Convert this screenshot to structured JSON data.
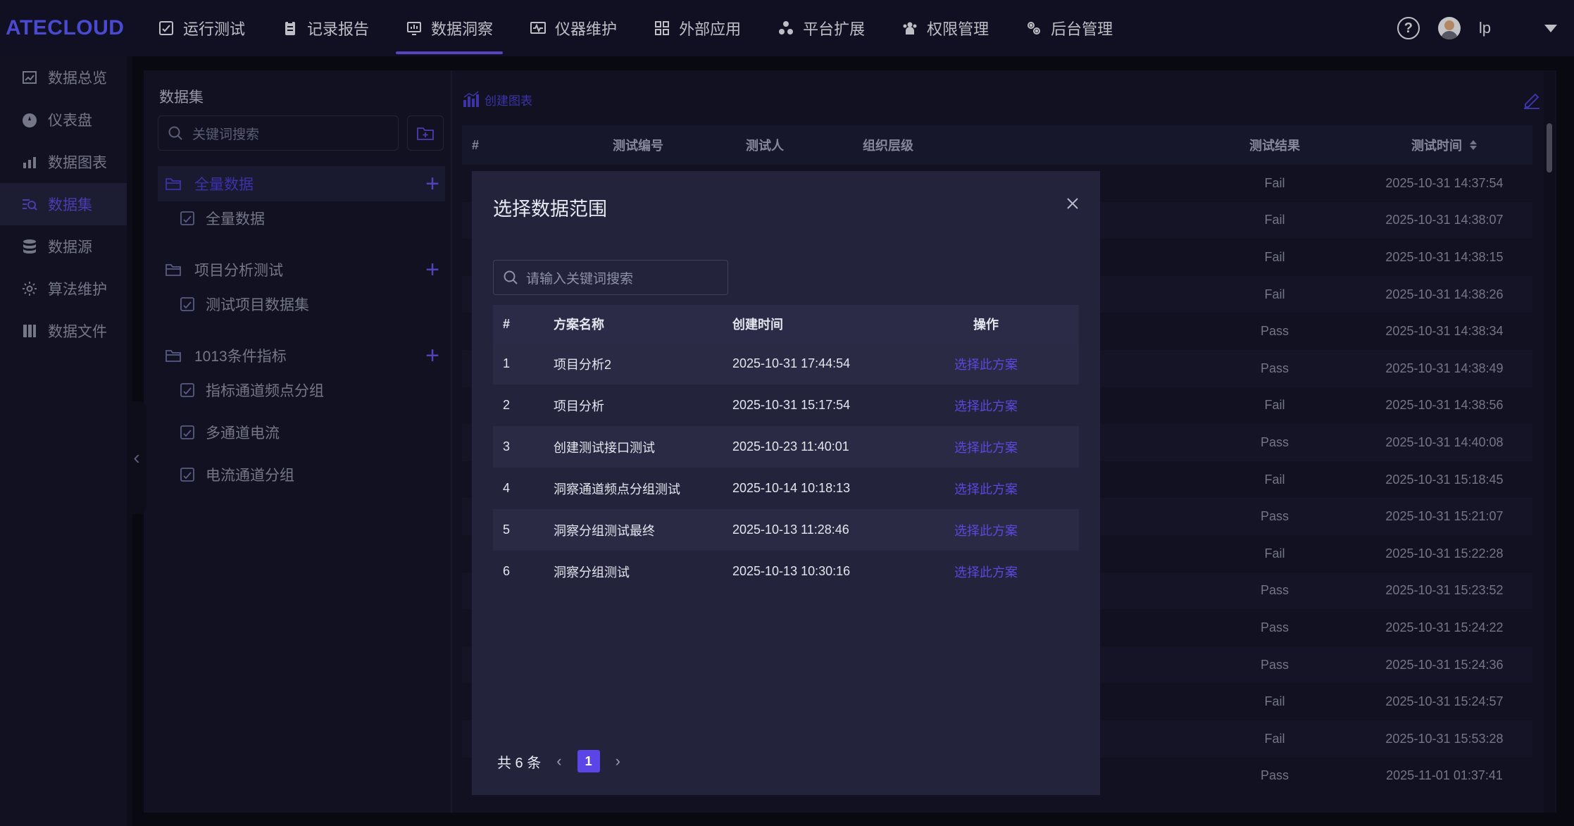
{
  "app": {
    "logo": "ATECLOUD"
  },
  "topnav": [
    {
      "label": "运行测试",
      "icon": "run-test-icon"
    },
    {
      "label": "记录报告",
      "icon": "report-icon"
    },
    {
      "label": "数据洞察",
      "icon": "insight-icon",
      "active": true
    },
    {
      "label": "仪器维护",
      "icon": "instrument-icon"
    },
    {
      "label": "外部应用",
      "icon": "apps-icon"
    },
    {
      "label": "平台扩展",
      "icon": "extension-icon"
    },
    {
      "label": "权限管理",
      "icon": "permission-icon"
    },
    {
      "label": "后台管理",
      "icon": "admin-icon"
    }
  ],
  "user": {
    "name": "lp",
    "help": "?"
  },
  "sidebar": [
    {
      "label": "数据总览",
      "icon": "overview-icon"
    },
    {
      "label": "仪表盘",
      "icon": "dashboard-icon"
    },
    {
      "label": "数据图表",
      "icon": "chart-icon"
    },
    {
      "label": "数据集",
      "icon": "dataset-icon",
      "active": true
    },
    {
      "label": "数据源",
      "icon": "database-icon"
    },
    {
      "label": "算法维护",
      "icon": "gear-icon"
    },
    {
      "label": "数据文件",
      "icon": "file-icon"
    }
  ],
  "dataset_panel": {
    "title": "数据集",
    "search_placeholder": "关键词搜索",
    "groups": [
      {
        "label": "全量数据",
        "selected": true,
        "leaves": [
          "全量数据"
        ]
      },
      {
        "label": "项目分析测试",
        "leaves": [
          "测试项目数据集"
        ]
      },
      {
        "label": "1013条件指标",
        "leaves": [
          "指标通道频点分组",
          "多通道电流",
          "电流通道分组"
        ]
      }
    ]
  },
  "main": {
    "create_chart": "创建图表",
    "columns": [
      "#",
      "测试编号",
      "测试人",
      "组织层级",
      "测试结果",
      "测试时间"
    ],
    "rows": [
      {
        "result": "Fail",
        "time": "2025-10-31 14:37:54"
      },
      {
        "result": "Fail",
        "time": "2025-10-31 14:38:07"
      },
      {
        "result": "Fail",
        "time": "2025-10-31 14:38:15"
      },
      {
        "result": "Fail",
        "time": "2025-10-31 14:38:26"
      },
      {
        "result": "Pass",
        "time": "2025-10-31 14:38:34"
      },
      {
        "result": "Pass",
        "time": "2025-10-31 14:38:49"
      },
      {
        "result": "Fail",
        "time": "2025-10-31 14:38:56"
      },
      {
        "result": "Pass",
        "time": "2025-10-31 14:40:08"
      },
      {
        "result": "Fail",
        "time": "2025-10-31 15:18:45"
      },
      {
        "result": "Pass",
        "time": "2025-10-31 15:21:07"
      },
      {
        "result": "Fail",
        "time": "2025-10-31 15:22:28"
      },
      {
        "result": "Pass",
        "time": "2025-10-31 15:23:52"
      },
      {
        "result": "Pass",
        "time": "2025-10-31 15:24:22"
      },
      {
        "result": "Pass",
        "time": "2025-10-31 15:24:36"
      },
      {
        "result": "Fail",
        "time": "2025-10-31 15:24:57"
      },
      {
        "result": "Fail",
        "time": "2025-10-31 15:53:28"
      },
      {
        "result": "Pass",
        "time": "2025-11-01 01:37:41"
      }
    ]
  },
  "modal": {
    "title": "选择数据范围",
    "search_placeholder": "请输入关键词搜索",
    "columns": [
      "#",
      "方案名称",
      "创建时间",
      "操作"
    ],
    "rows": [
      {
        "idx": "1",
        "name": "项目分析2",
        "time": "2025-10-31 17:44:54",
        "action": "选择此方案"
      },
      {
        "idx": "2",
        "name": "项目分析",
        "time": "2025-10-31 15:17:54",
        "action": "选择此方案"
      },
      {
        "idx": "3",
        "name": "创建测试接口测试",
        "time": "2025-10-23 11:40:01",
        "action": "选择此方案"
      },
      {
        "idx": "4",
        "name": "洞察通道频点分组测试",
        "time": "2025-10-14 10:18:13",
        "action": "选择此方案"
      },
      {
        "idx": "5",
        "name": "洞察分组测试最终",
        "time": "2025-10-13 11:28:46",
        "action": "选择此方案"
      },
      {
        "idx": "6",
        "name": "洞察分组测试",
        "time": "2025-10-13 10:30:16",
        "action": "选择此方案"
      }
    ],
    "pagination": {
      "total": "共 6 条",
      "current_page": "1",
      "prev": "‹",
      "next": "›"
    }
  },
  "colors": {
    "accent": "#5b45e6",
    "link": "#5a49de",
    "logo": "#5b5bff"
  }
}
